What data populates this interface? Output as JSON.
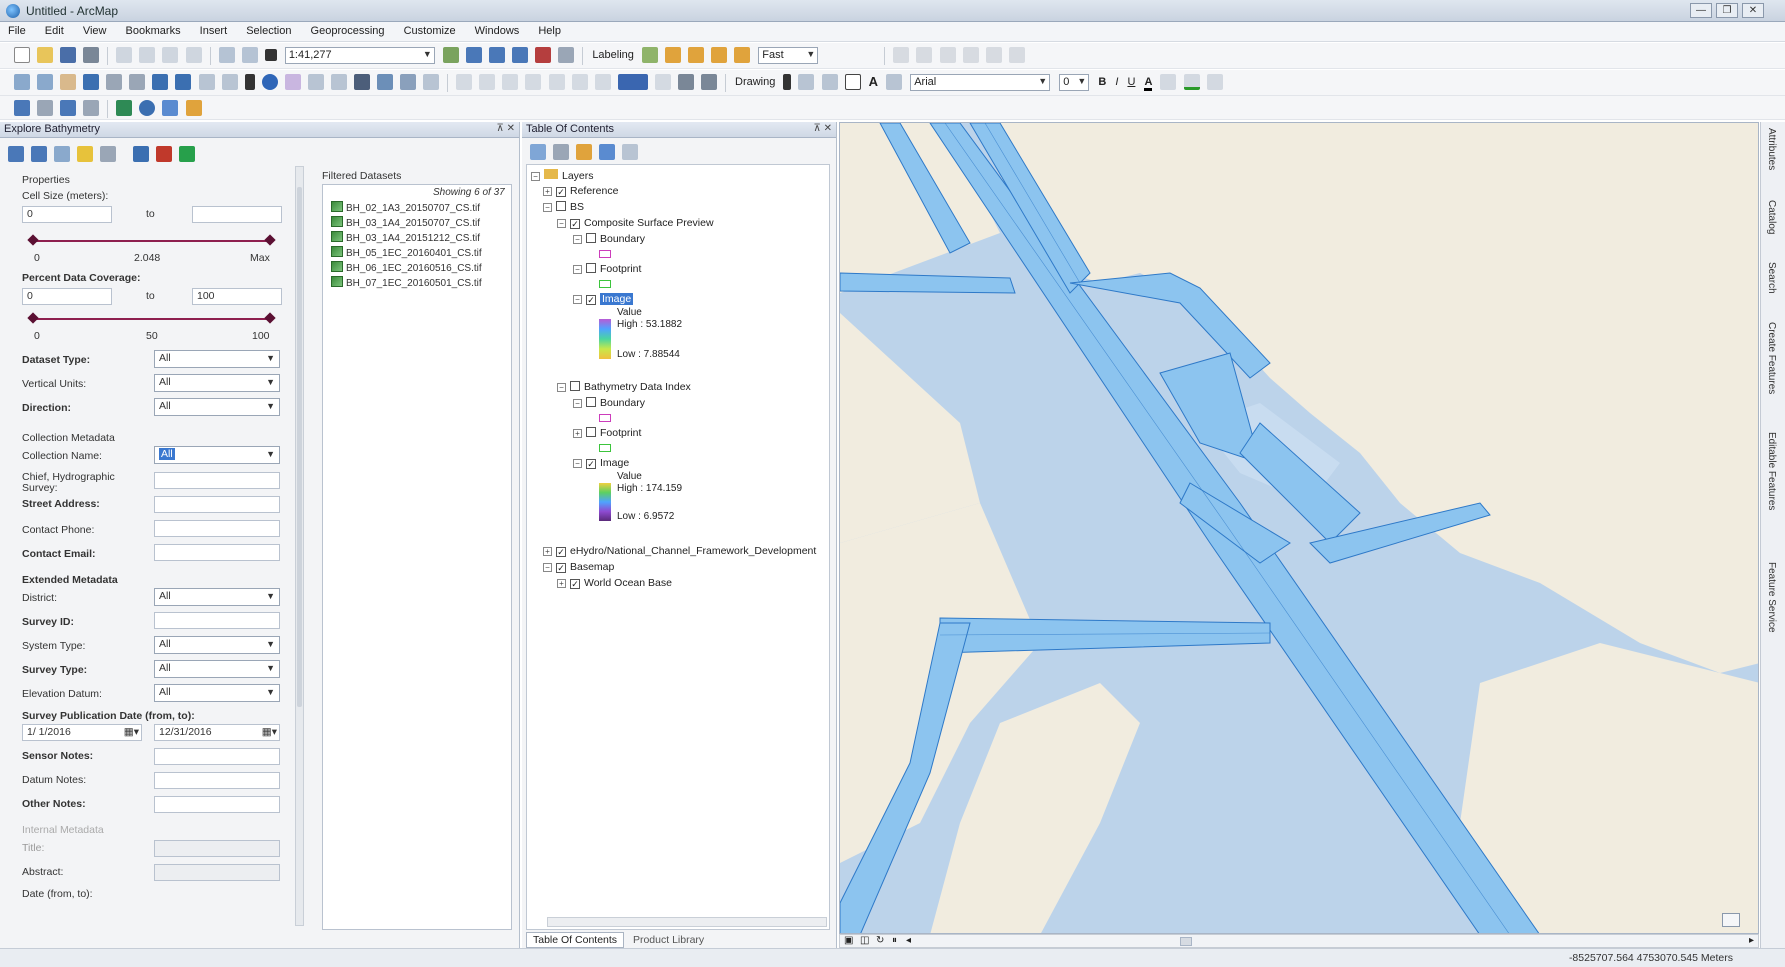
{
  "window": {
    "title": "Untitled - ArcMap",
    "controls": [
      "—",
      "❐",
      "✕"
    ]
  },
  "menu": [
    "File",
    "Edit",
    "View",
    "Bookmarks",
    "Insert",
    "Selection",
    "Geoprocessing",
    "Customize",
    "Windows",
    "Help"
  ],
  "toolbar": {
    "scale_value": "1:41,277",
    "labeling_label": "Labeling",
    "labeling_select": "Fast",
    "drawing_label": "Drawing",
    "font_name": "Arial",
    "font_size": "0",
    "bold": "B",
    "italic": "I",
    "underline": "U",
    "font_color": "A"
  },
  "explore_panel": {
    "title": "Explore Bathymetry",
    "properties_heading": "Properties",
    "cell_size_label": "Cell Size (meters):",
    "cell_size_from": "0",
    "to_label": "to",
    "cell_size_to": "",
    "cell_ticks": [
      "0",
      "2.048",
      "Max"
    ],
    "coverage_label": "Percent Data Coverage:",
    "coverage_from": "0",
    "coverage_to": "100",
    "coverage_ticks": [
      "0",
      "50",
      "100"
    ],
    "dataset_type_label": "Dataset Type:",
    "vertical_units_label": "Vertical Units:",
    "direction_label": "Direction:",
    "all_value": "All",
    "collection_heading": "Collection Metadata",
    "collection_name_label": "Collection Name:",
    "collection_name_value": "All",
    "chief_label": "Chief, Hydrographic Survey:",
    "street_label": "Street Address:",
    "contact_phone_label": "Contact Phone:",
    "contact_email_label": "Contact Email:",
    "extended_heading": "Extended Metadata",
    "district_label": "District:",
    "survey_id_label": "Survey ID:",
    "system_type_label": "System Type:",
    "survey_type_label": "Survey Type:",
    "elevation_datum_label": "Elevation Datum:",
    "pub_date_label": "Survey Publication Date (from, to):",
    "pub_date_from": "1/ 1/2016",
    "pub_date_to": "12/31/2016",
    "sensor_notes_label": "Sensor Notes:",
    "datum_notes_label": "Datum Notes:",
    "other_notes_label": "Other Notes:",
    "internal_heading": "Internal Metadata",
    "title_label": "Title:",
    "abstract_label": "Abstract:",
    "date_label": "Date (from, to):"
  },
  "filtered": {
    "heading": "Filtered Datasets",
    "showing": "Showing 6 of 37",
    "items": [
      "BH_02_1A3_20150707_CS.tif",
      "BH_03_1A4_20150707_CS.tif",
      "BH_03_1A4_20151212_CS.tif",
      "BH_05_1EC_20160401_CS.tif",
      "BH_06_1EC_20160516_CS.tif",
      "BH_07_1EC_20160501_CS.tif"
    ]
  },
  "toc": {
    "title": "Table Of Contents",
    "layers": "Layers",
    "reference": "Reference",
    "bs": "BS",
    "composite": "Composite Surface Preview",
    "boundary": "Boundary",
    "footprint": "Footprint",
    "image": "Image",
    "value": "Value",
    "high1": "High : 53.1882",
    "low1": "Low : 7.88544",
    "bathy_index": "Bathymetry Data Index",
    "high2": "High : 174.159",
    "low2": "Low : 6.9572",
    "ehydro": "eHydro/National_Channel_Framework_Development",
    "basemap": "Basemap",
    "ocean": "World Ocean Base",
    "tab_toc": "Table Of Contents",
    "tab_catalog": "Product Library"
  },
  "right_rail": [
    "Attributes",
    "Catalog",
    "Search",
    "Create Features",
    "Editable Features",
    "Feature Service"
  ],
  "status": {
    "coordinates": "-8525707.564  4753070.545 Meters"
  },
  "colors": {
    "water": "#bcd3ea",
    "land": "#f1ecdf",
    "channel": "#8cc4ef",
    "channel_line": "#2e79c8"
  }
}
